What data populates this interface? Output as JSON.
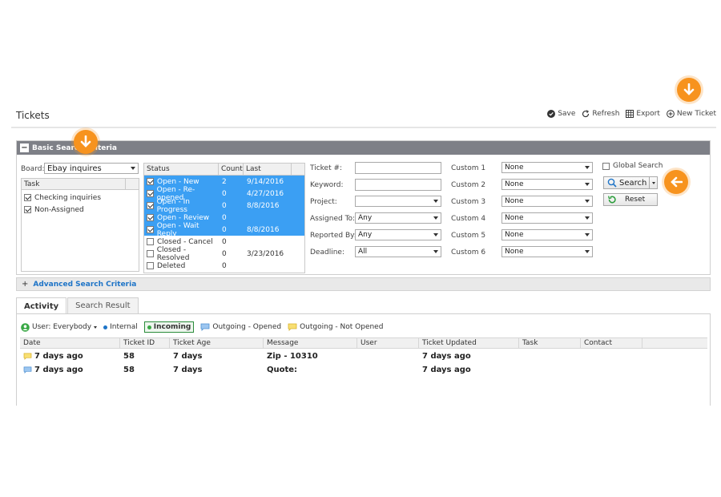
{
  "page": {
    "title": "Tickets"
  },
  "toolbar": {
    "save": "Save",
    "refresh": "Refresh",
    "export": "Export",
    "new_ticket": "New Ticket"
  },
  "basic_search": {
    "header": "Basic Search Criteria",
    "board_label": "Board:",
    "board_value": "Ebay inquires",
    "task_header": "Task",
    "tasks": [
      {
        "label": "Checking inquiries",
        "checked": true
      },
      {
        "label": "Non-Assigned",
        "checked": true
      }
    ],
    "status_headers": {
      "status": "Status",
      "count": "Count",
      "last": "Last"
    },
    "statuses": [
      {
        "label": "Open - New",
        "count": "2",
        "last": "9/14/2016",
        "checked": true
      },
      {
        "label": "Open - Re-opened",
        "count": "0",
        "last": "4/27/2016",
        "checked": true
      },
      {
        "label": "Open - In Progress",
        "count": "0",
        "last": "8/8/2016",
        "checked": true
      },
      {
        "label": "Open - Review",
        "count": "0",
        "last": "",
        "checked": true
      },
      {
        "label": "Open - Wait Reply",
        "count": "0",
        "last": "8/8/2016",
        "checked": true
      },
      {
        "label": "Closed - Cancel",
        "count": "0",
        "last": "",
        "checked": false
      },
      {
        "label": "Closed - Resolved",
        "count": "0",
        "last": "3/23/2016",
        "checked": false
      },
      {
        "label": "Deleted",
        "count": "0",
        "last": "",
        "checked": false
      }
    ],
    "fields": {
      "ticket_no": "Ticket #:",
      "keyword": "Keyword:",
      "project": "Project:",
      "assigned_to": "Assigned To:",
      "assigned_to_value": "Any",
      "reported_by": "Reported By:",
      "reported_by_value": "Any",
      "deadline": "Deadline:",
      "deadline_value": "All"
    },
    "custom": [
      {
        "label": "Custom 1",
        "value": "None"
      },
      {
        "label": "Custom 2",
        "value": "None"
      },
      {
        "label": "Custom 3",
        "value": "None"
      },
      {
        "label": "Custom 4",
        "value": "None"
      },
      {
        "label": "Custom 5",
        "value": "None"
      },
      {
        "label": "Custom 6",
        "value": "None"
      }
    ],
    "global_search": "Global Search",
    "search_button": "Search",
    "reset_button": "Reset"
  },
  "advanced": {
    "label": "Advanced Search Criteria"
  },
  "tabs": [
    {
      "label": "Activity"
    },
    {
      "label": "Search Result"
    }
  ],
  "filters": {
    "user": "User: Everybody",
    "internal": "Internal",
    "incoming": "Incoming",
    "outgoing_opened": "Outgoing - Opened",
    "outgoing_not_opened": "Outgoing - Not Opened"
  },
  "grid": {
    "headers": [
      "Date",
      "Ticket ID",
      "Ticket Age",
      "Message",
      "User",
      "Ticket Updated",
      "Task",
      "Contact"
    ],
    "rows": [
      {
        "date": "7 days ago",
        "ticket_id": "58",
        "age": "7 days",
        "message": "Zip - 10310",
        "user": "",
        "updated": "7 days ago",
        "task": "",
        "contact": ""
      },
      {
        "date": "7 days ago",
        "ticket_id": "58",
        "age": "7 days",
        "message": "Quote:",
        "user": "",
        "updated": "7 days ago",
        "task": "",
        "contact": ""
      }
    ]
  },
  "colors": {
    "accent": "#f7931e",
    "selection": "#3b9ff3",
    "header_bar": "#7e8087",
    "link": "#1e74c7"
  }
}
